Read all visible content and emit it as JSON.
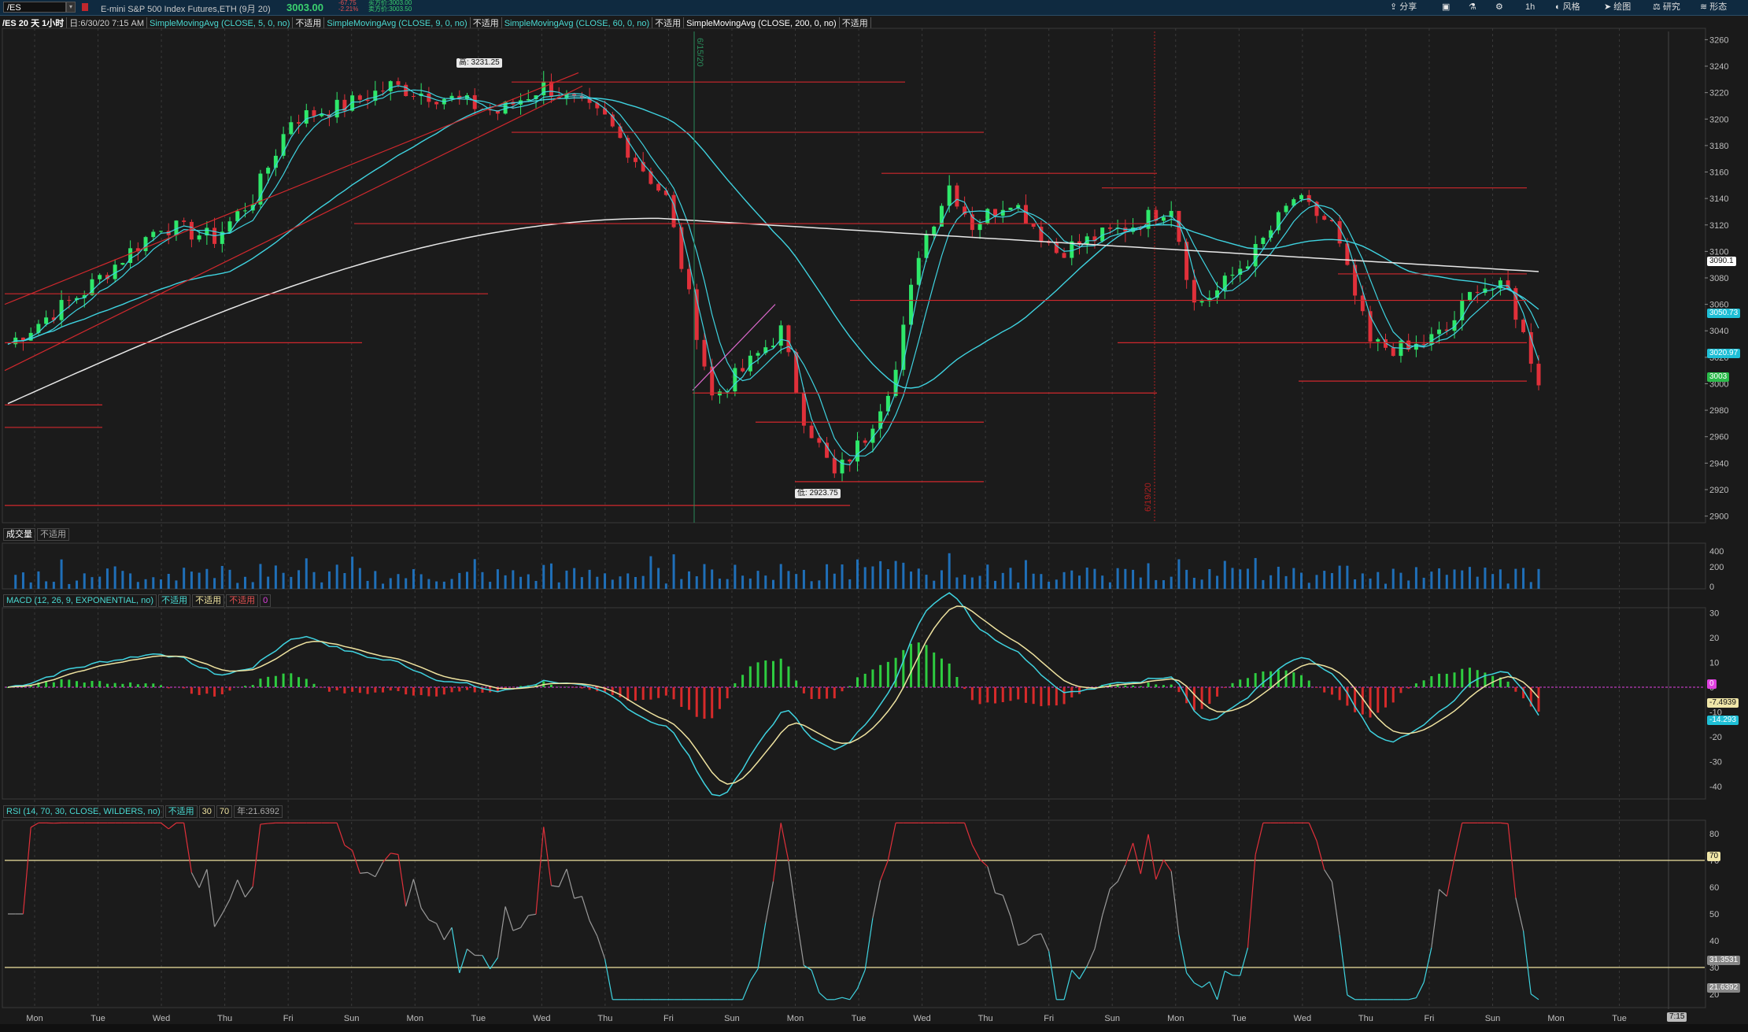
{
  "topbar": {
    "symbol": "/ES",
    "description": "E-mini S&P 500 Index Futures,ETH (9月 20)",
    "last_price": "3003.00",
    "change_pct": "-67.75",
    "change_pct2": "-2.21%",
    "bid": "买方价:3003.00",
    "ask": "卖方价:3003.50",
    "buttons": [
      {
        "label": "分享",
        "icon": "share-icon"
      },
      {
        "label": "",
        "icon": "grid-icon"
      },
      {
        "label": "",
        "icon": "flask-icon"
      },
      {
        "label": "",
        "icon": "gear-icon"
      },
      {
        "label": "1h",
        "icon": ""
      },
      {
        "label": "风格",
        "icon": "style-icon"
      },
      {
        "label": "绘图",
        "icon": "cursor-icon"
      },
      {
        "label": "研究",
        "icon": "study-icon"
      },
      {
        "label": "形态",
        "icon": "pattern-icon"
      }
    ]
  },
  "studybar": {
    "title": "/ES 20 天 1小时",
    "date": "日:6/30/20 7:15 AM",
    "studies": [
      {
        "label": "SimpleMovingAvg (CLOSE, 5, 0, no)",
        "value": "不适用",
        "color": "#4ad9d2"
      },
      {
        "label": "SimpleMovingAvg (CLOSE, 9, 0, no)",
        "value": "不适用",
        "color": "#4ad9d2"
      },
      {
        "label": "SimpleMovingAvg (CLOSE, 60, 0, no)",
        "value": "不适用",
        "color": "#4ad9d2"
      },
      {
        "label": "SimpleMovingAvg (CLOSE, 200, 0, no)",
        "value": "不适用",
        "color": "#ffffff"
      }
    ]
  },
  "volume_panel": {
    "title": "成交量",
    "value": "不适用"
  },
  "macd_panel": {
    "title": "MACD (12, 26, 9, EXPONENTIAL, no)",
    "values": [
      "不适用",
      "不适用",
      "不适用",
      "0"
    ]
  },
  "rsi_panel": {
    "title": "RSI (14, 70, 30, CLOSE, WILDERS, no)",
    "values": [
      "不适用",
      "30",
      "70",
      "年:21.6392"
    ]
  },
  "annotations": {
    "high": "高: 3231.25",
    "low": "低: 2923.75",
    "vline1": "6/15/20",
    "vline2": "6/19/20"
  },
  "price_tags": [
    {
      "label": "3090.1",
      "bg": "#ffffff",
      "fg": "#111"
    },
    {
      "label": "3050.73",
      "bg": "#1fbfd6",
      "fg": "#fff"
    },
    {
      "label": "3020.97",
      "bg": "#1fbfd6",
      "fg": "#fff"
    },
    {
      "label": "3003",
      "bg": "#2bbb4a",
      "fg": "#fff"
    }
  ],
  "volume_tags": {
    "axis": [
      "400",
      "200",
      "0"
    ]
  },
  "macd_tags": [
    {
      "label": "0",
      "bg": "#e040e0",
      "fg": "#fff"
    },
    {
      "label": "-7.4939",
      "bg": "#f0e6a8",
      "fg": "#111"
    },
    {
      "label": "-14.293",
      "bg": "#1fbfd6",
      "fg": "#fff"
    }
  ],
  "rsi_tags": [
    {
      "label": "70",
      "bg": "#f0e6a8",
      "fg": "#111"
    },
    {
      "label": "31.3531",
      "bg": "#888888",
      "fg": "#fff"
    },
    {
      "label": "21.6392",
      "bg": "#888888",
      "fg": "#fff"
    }
  ],
  "time_axis": [
    "Mon",
    "Tue",
    "Wed",
    "Thu",
    "Fri",
    "Sun",
    "Mon",
    "Tue",
    "Wed",
    "Thu",
    "Fri",
    "Sun",
    "Mon",
    "Tue",
    "Wed",
    "Thu",
    "Fri",
    "Sun",
    "Mon",
    "Tue",
    "Wed",
    "Thu",
    "Fri",
    "Sun",
    "Mon",
    "Tue"
  ],
  "time_tag": "7:15",
  "colors": {
    "up": "#2ee86a",
    "down": "#e0303a",
    "sma_fast": "#3fd3e0",
    "sma200": "#e8e8e8",
    "resistance": "#d0282d",
    "macd_line": "#3fd3e0",
    "signal": "#efe3a0",
    "rsi": "#9a9a9a",
    "rsi_ob": "#e0303a",
    "rsi_os": "#3fd3e0"
  },
  "chart_data": [
    {
      "type": "candlestick",
      "title": "/ES 20 天 1小时",
      "ylabel": "",
      "y_ticks": [
        3260,
        3240,
        3220,
        3200,
        3180,
        3160,
        3140,
        3120,
        3100,
        3080,
        3060,
        3040,
        3020,
        3000,
        2980,
        2960,
        2940,
        2920,
        2900
      ],
      "ylim": [
        2895,
        3265
      ],
      "grid": "vertical dotted",
      "high": 3231.25,
      "low": 2923.75,
      "last": 3003,
      "sma_last": {
        "sma200": 3090.1,
        "sma60": 3050.73,
        "sma9": 3020.97
      },
      "path_keypoints": [
        [
          0,
          3030
        ],
        [
          5,
          3050
        ],
        [
          10,
          3070
        ],
        [
          16,
          3100
        ],
        [
          20,
          3120
        ],
        [
          27,
          3110
        ],
        [
          32,
          3140
        ],
        [
          37,
          3200
        ],
        [
          44,
          3210
        ],
        [
          50,
          3225
        ],
        [
          58,
          3215
        ],
        [
          64,
          3205
        ],
        [
          70,
          3225
        ],
        [
          78,
          3200
        ],
        [
          86,
          3140
        ],
        [
          92,
          2990
        ],
        [
          96,
          3010
        ],
        [
          101,
          3040
        ],
        [
          104,
          2975
        ],
        [
          108,
          2930
        ],
        [
          112,
          2960
        ],
        [
          116,
          3010
        ],
        [
          119,
          3100
        ],
        [
          123,
          3150
        ],
        [
          126,
          3120
        ],
        [
          131,
          3140
        ],
        [
          137,
          3100
        ],
        [
          142,
          3110
        ],
        [
          147,
          3120
        ],
        [
          152,
          3135
        ],
        [
          155,
          3060
        ],
        [
          158,
          3070
        ],
        [
          163,
          3100
        ],
        [
          168,
          3140
        ],
        [
          173,
          3120
        ],
        [
          178,
          3030
        ],
        [
          183,
          3025
        ],
        [
          188,
          3040
        ],
        [
          192,
          3075
        ],
        [
          196,
          3070
        ],
        [
          200,
          3003
        ]
      ]
    },
    {
      "type": "bar",
      "title": "成交量",
      "y_ticks": [
        400,
        200,
        0
      ]
    },
    {
      "type": "line",
      "title": "MACD (12, 26, 9, EXPONENTIAL, no)",
      "y_ticks": [
        30,
        20,
        10,
        0,
        -10,
        -20,
        -30,
        -40
      ],
      "ylim": [
        -45,
        32
      ],
      "last": {
        "value": -14.293,
        "avg": -7.4939
      }
    },
    {
      "type": "line",
      "title": "RSI (14, 70, 30, CLOSE, WILDERS, no)",
      "y_ticks": [
        80,
        70,
        60,
        50,
        40,
        30,
        20
      ],
      "ylim": [
        15,
        85
      ],
      "overbought": 70,
      "oversold": 30,
      "last": 31.3531
    }
  ]
}
